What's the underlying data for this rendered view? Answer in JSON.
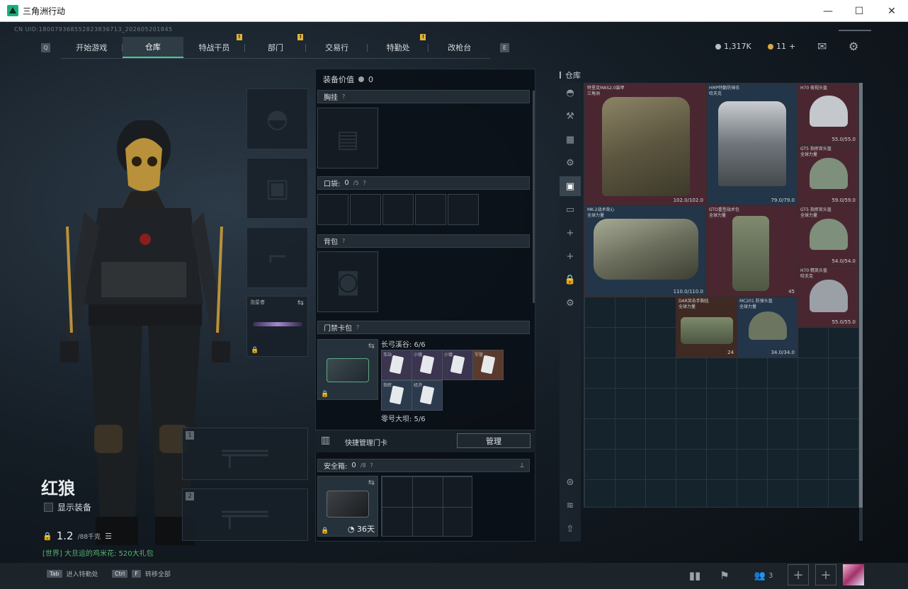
{
  "window": {
    "title": "三角洲行动",
    "min": "—",
    "max": "☐",
    "close": "✕"
  },
  "uid": "CN UID:180079368552823836713_202605201845",
  "nav": {
    "left_key": "Q",
    "right_key": "E",
    "tabs": [
      {
        "label": "开始游戏",
        "badge": ""
      },
      {
        "label": "仓库",
        "badge": ""
      },
      {
        "label": "特战干员",
        "badge": "!"
      },
      {
        "label": "部门",
        "badge": "!"
      },
      {
        "label": "交易行",
        "badge": ""
      },
      {
        "label": "特勤处",
        "badge": "!"
      },
      {
        "label": "改枪台",
        "badge": ""
      }
    ]
  },
  "currency": {
    "hafu": "1,317K",
    "coupon": "11",
    "plus": "+"
  },
  "operator": {
    "name": "红狼",
    "show_equipment": "显示装备",
    "weight": "1.2",
    "weight_unit": "/88千克"
  },
  "chat": "[世界] 大旦运的鸡米花: 520大礼包",
  "slots": {
    "slot1": "1",
    "slot2": "2",
    "weapon_label": "泡星者"
  },
  "mid": {
    "equip_value_label": "装备价值",
    "equip_value": "0",
    "chest_rig": "胸挂",
    "pockets": "口袋:",
    "pockets_count": "0",
    "pockets_max": "/5",
    "backpack": "背包",
    "keycard_pack": "门禁卡包",
    "row1_label": "长弓溪谷: 6/6",
    "row2_label": "零号大坝: 5/6",
    "cards_row1": [
      "车站",
      "小镇",
      "小镇",
      "军营"
    ],
    "cards_row2": [
      "指挥",
      "经济"
    ],
    "quick_manage": "快捷管理门卡",
    "manage_btn": "管理",
    "safe_box": "安全箱:",
    "safe_count": "0",
    "safe_max": "/8",
    "safe_days": "36天"
  },
  "warehouse": {
    "title": "仓库",
    "items": [
      {
        "name": "特里克MAS2.0装甲",
        "sub": "三角洲",
        "dur": "102.0/102.0"
      },
      {
        "name": "HMP特勤防弹衣",
        "sub": "哈夫克",
        "dur": "79.0/79.0"
      },
      {
        "name": "H70 夜视头盔",
        "sub": "哈夫克",
        "dur": "55.0/55.0"
      },
      {
        "name": "GT5 指挥官头盔",
        "sub": "全球力量",
        "dur": "59.0/59.0"
      },
      {
        "name": "MK-2战术背心",
        "sub": "全球力量",
        "dur": "110.0/110.0"
      },
      {
        "name": "GTO重型战术包",
        "sub": "全球力量",
        "dur": "45"
      },
      {
        "name": "GT5 指挥官头盔",
        "sub": "全球力量",
        "dur": "54.0/54.0"
      },
      {
        "name": "H70 精英头盔",
        "sub": "哈夫克",
        "dur": "55.0/55.0"
      },
      {
        "name": "DAR突击手胸挂",
        "sub": "全球力量",
        "dur": "24"
      },
      {
        "name": "MC201 防弹头盔",
        "sub": "全球力量",
        "dur": "34.0/34.0"
      }
    ]
  },
  "bottom": {
    "tab_key": "Tab",
    "tab_label": "进入特勤处",
    "ctrl_key": "Ctrl",
    "f_key": "F",
    "ctrl_label": "转移全部",
    "team_count": "3",
    "plus": "+"
  }
}
